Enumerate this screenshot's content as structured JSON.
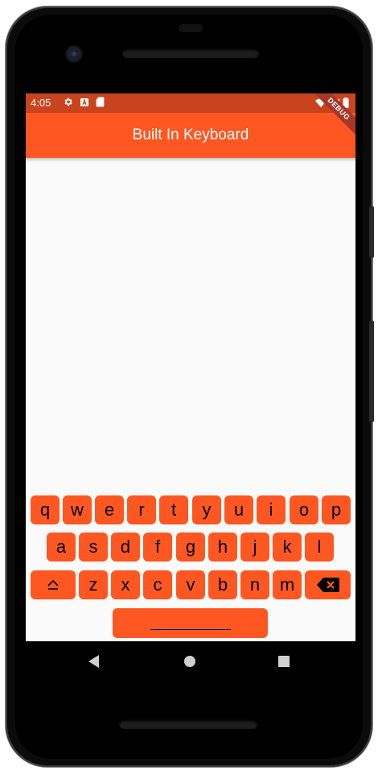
{
  "status_bar": {
    "time": "4:05",
    "icons": [
      "gear-icon",
      "a-badge-icon",
      "sd-card-icon"
    ],
    "right_icons": [
      "wifi-icon",
      "signal-icon",
      "battery-icon"
    ]
  },
  "app_bar": {
    "title": "Built In Keyboard",
    "debug_banner": "DEBUG"
  },
  "keyboard": {
    "row1": [
      "q",
      "w",
      "e",
      "r",
      "t",
      "y",
      "u",
      "i",
      "o",
      "p"
    ],
    "row2": [
      "a",
      "s",
      "d",
      "f",
      "g",
      "h",
      "j",
      "k",
      "l"
    ],
    "row3_letters": [
      "z",
      "x",
      "c",
      "v",
      "b",
      "n",
      "m"
    ],
    "shift_icon": "shift-icon",
    "backspace_icon": "backspace-icon",
    "space_icon": "space-bar"
  },
  "colors": {
    "accent": "#ff5722",
    "status_bar": "#c8441e",
    "background": "#fafafa"
  },
  "nav_bar": {
    "icons": [
      "back-icon",
      "home-icon",
      "recents-icon"
    ]
  }
}
